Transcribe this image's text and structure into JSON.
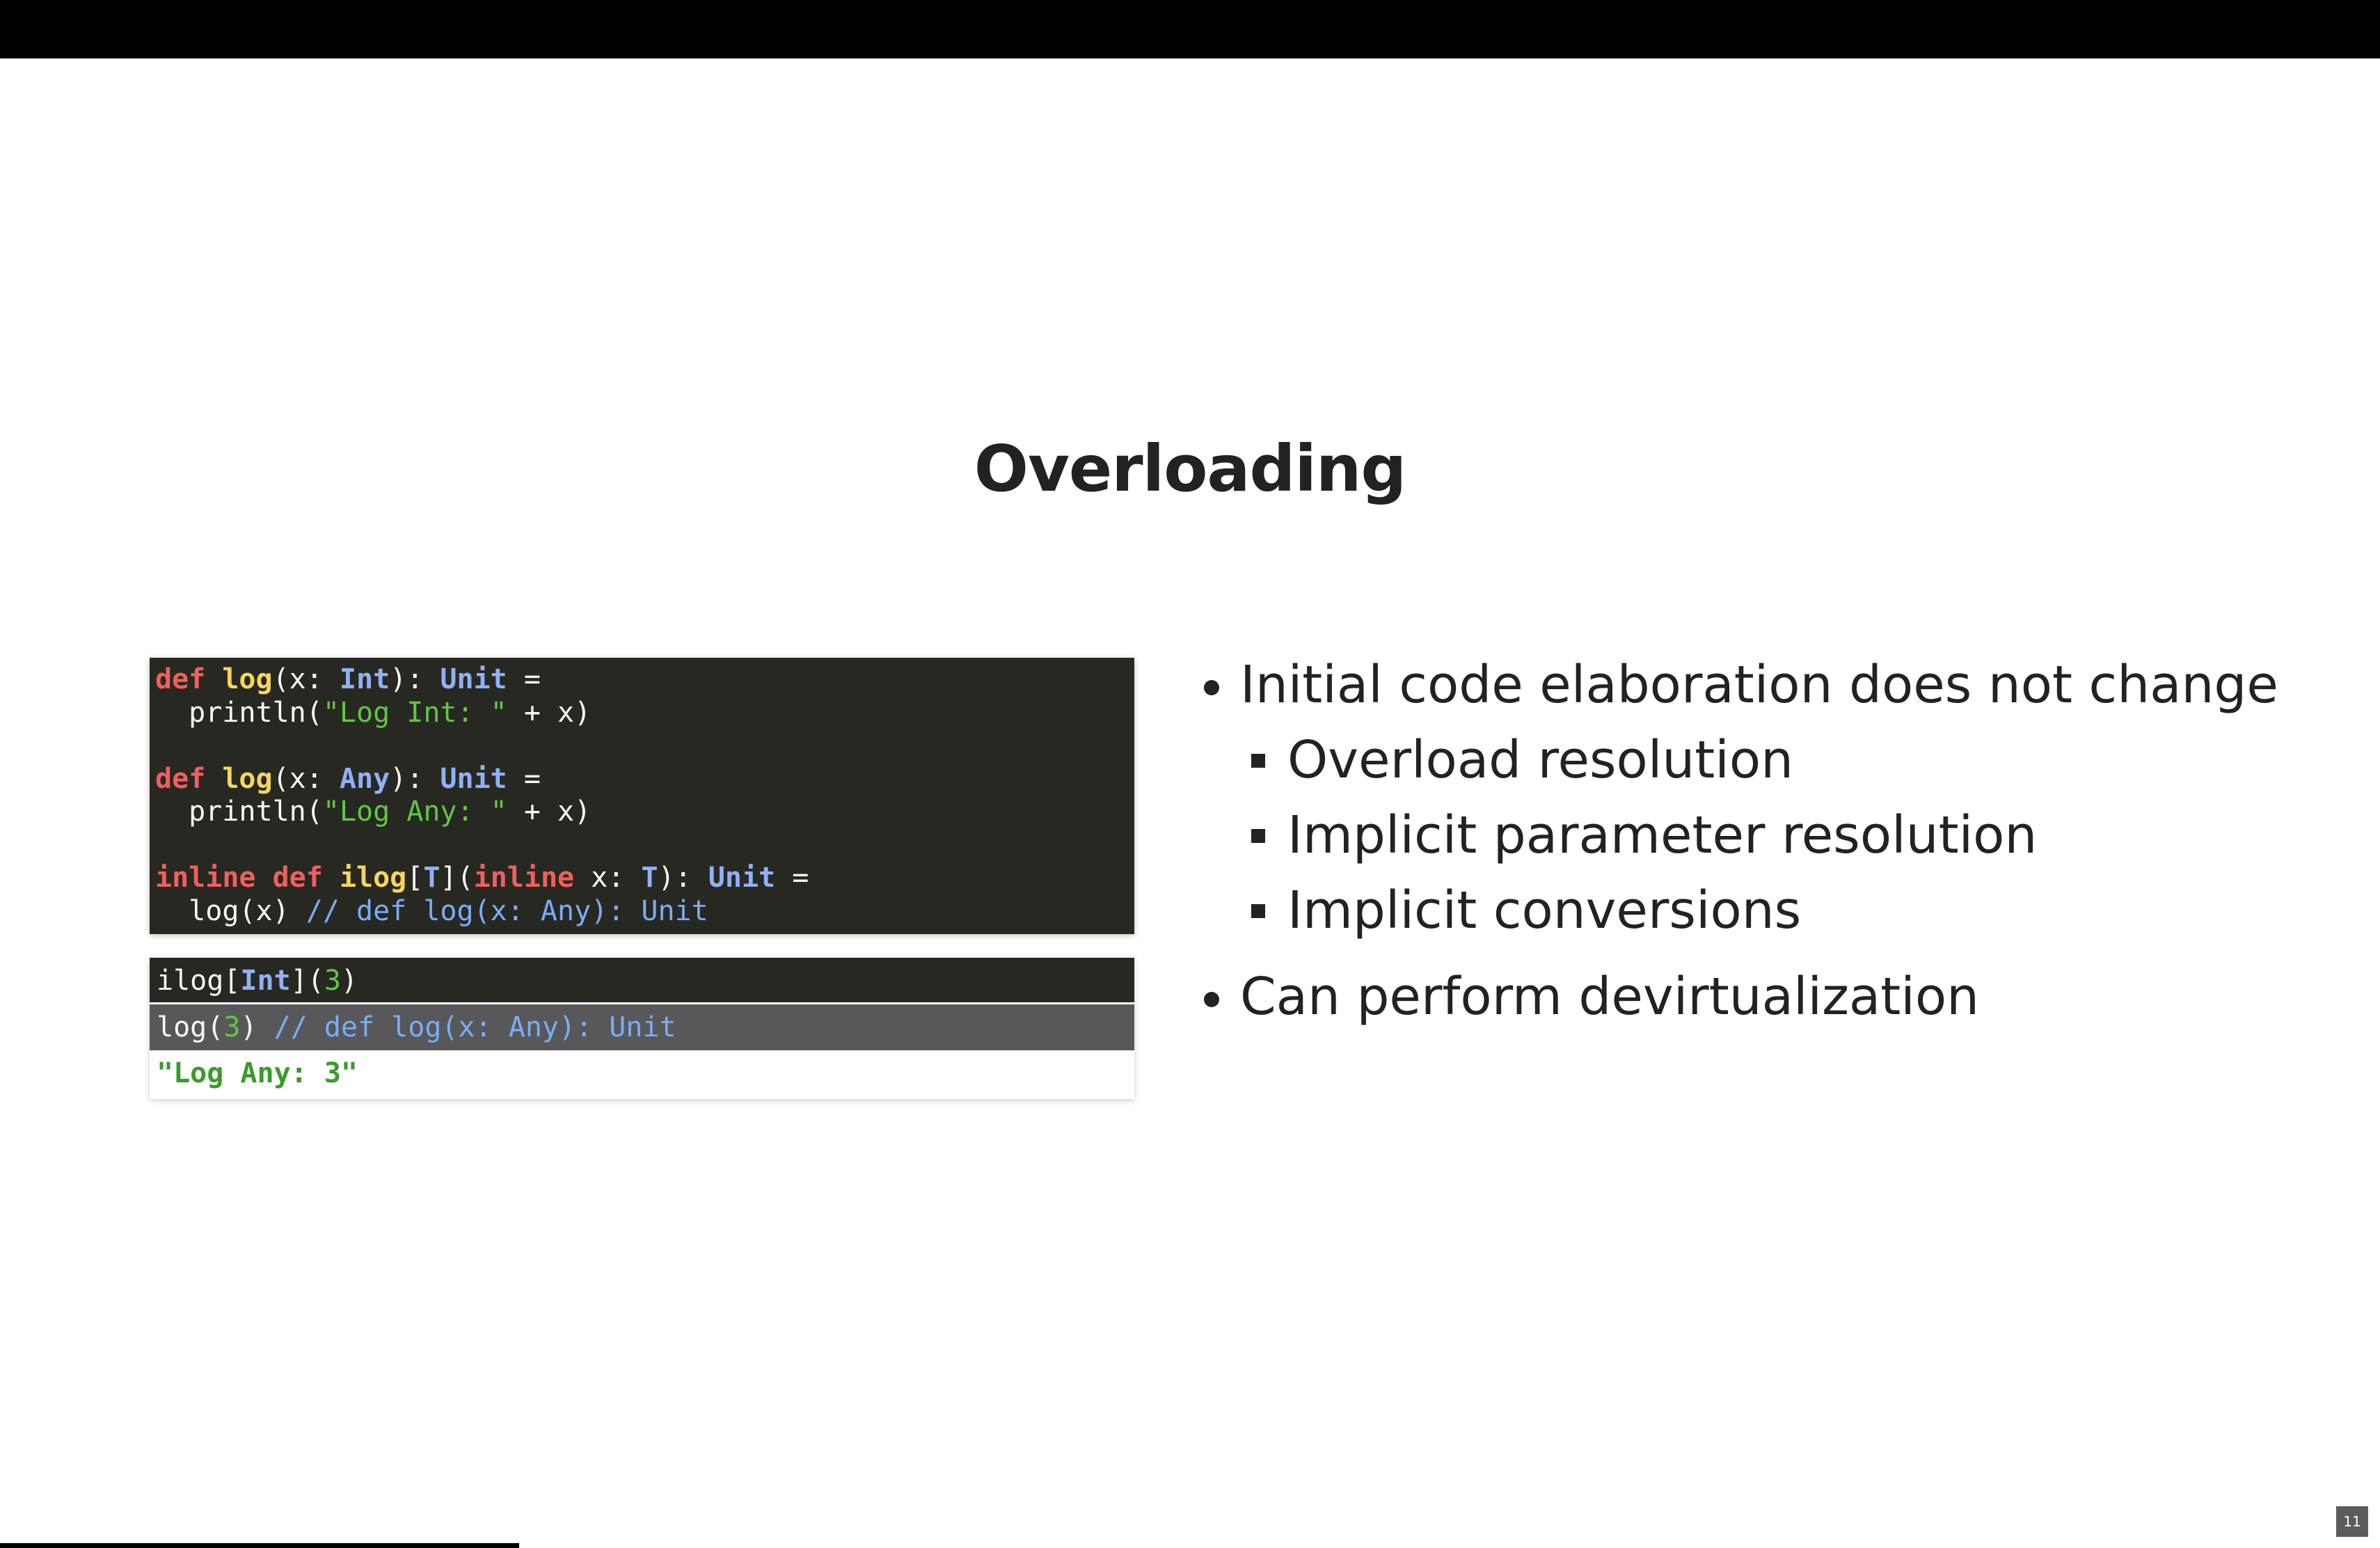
{
  "slide": {
    "title": "Overloading",
    "page_number": "11"
  },
  "code": {
    "line1": {
      "kw": "def",
      "fn": "log",
      "p1": "(x: ",
      "ty1": "Int",
      "p2": "): ",
      "ty2": "Unit",
      "p3": " ="
    },
    "line2": {
      "p1": "  println(",
      "str": "\"Log Int: \"",
      "p2": " + x)"
    },
    "line3": {
      "kw": "def",
      "fn": "log",
      "p1": "(x: ",
      "ty1": "Any",
      "p2": "): ",
      "ty2": "Unit",
      "p3": " ="
    },
    "line4": {
      "p1": "  println(",
      "str": "\"Log Any: \"",
      "p2": " + x)"
    },
    "line5": {
      "kw1": "inline",
      "kw2": "def",
      "fn": "ilog",
      "p1": "[",
      "ty1": "T",
      "p2": "](",
      "kw3": "inline",
      "p3": " x: ",
      "ty2": "T",
      "p4": "): ",
      "ty3": "Unit",
      "p5": " ="
    },
    "line6": {
      "p1": "  log(x) ",
      "cm": "// def log(x: Any): Unit"
    }
  },
  "run": {
    "input": {
      "p1": "ilog[",
      "ty": "Int",
      "p2": "](",
      "num": "3",
      "p3": ")"
    },
    "expansion": {
      "p1": "log(",
      "num": "3",
      "p2": ") ",
      "cm": "// def log(x: Any): Unit"
    },
    "output": "\"Log Any: 3\""
  },
  "bullets": {
    "item1": "Initial code elaboration does not change",
    "sub1": "Overload resolution",
    "sub2": "Implicit parameter resolution",
    "sub3": "Implicit conversions",
    "item2": "Can perform devirtualization"
  },
  "colors": {
    "code_bg": "#272822",
    "keyword": "#f25f5c",
    "function": "#f6d55c",
    "type": "#8fb1f5",
    "string": "#5fc842",
    "comment": "#78aef7",
    "expansion_bg": "#58585a",
    "output_text": "#3a9a2a"
  }
}
